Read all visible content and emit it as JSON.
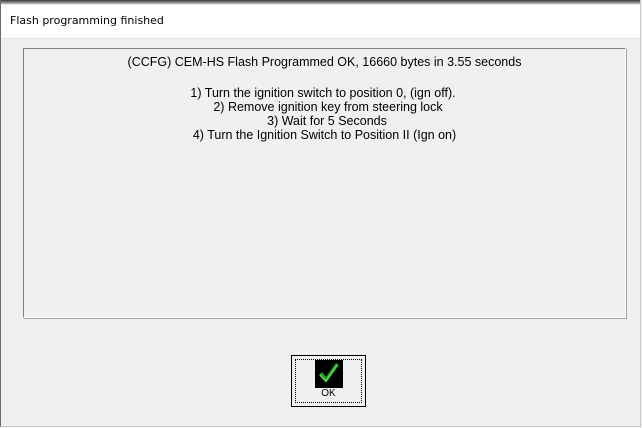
{
  "window": {
    "title": "Flash programming finished"
  },
  "message": {
    "headline": "(CCFG) CEM-HS  Flash Programmed OK, 16660 bytes in 3.55 seconds",
    "steps": [
      "1)  Turn the ignition switch to position 0, (ign off).",
      "2)  Remove ignition key from steering lock",
      "3)  Wait for 5 Seconds",
      "4)  Turn the Ignition Switch to Position II (Ign on)"
    ]
  },
  "ok_button": {
    "label": "OK",
    "icon": "checkmark-icon"
  },
  "colors": {
    "check_green": "#1aa81a",
    "check_bg": "#000000",
    "window_bg": "#f0f0f0"
  }
}
